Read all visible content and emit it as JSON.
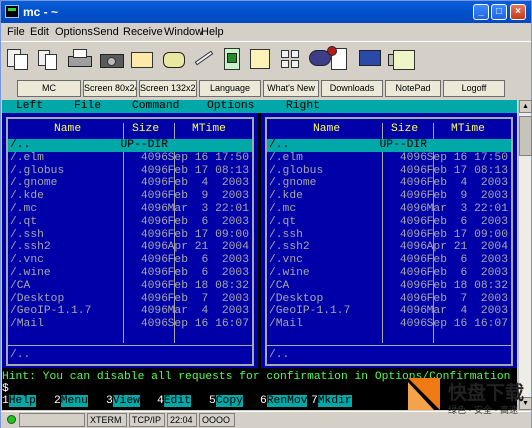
{
  "window": {
    "title": "mc - ~",
    "controls": [
      "_",
      "□",
      "×"
    ]
  },
  "menubar": [
    "File",
    "Edit",
    "Options",
    "Send",
    "Receive",
    "Window",
    "Help"
  ],
  "toolbar_icons": [
    "paste-icon",
    "copy-icon",
    "print-icon",
    "camera-icon",
    "open-icon",
    "phone-icon",
    "send-icon",
    "upload-icon",
    "download-icon",
    "grid-icon",
    "chat-icon",
    "spellcheck-icon",
    "display-icon",
    "keyboard-icon",
    "image-icon"
  ],
  "buttons": [
    "MC",
    "Screen 80x24",
    "Screen 132x24",
    "Language",
    "What's New",
    "Downloads",
    "NotePad",
    "Logoff"
  ],
  "mc_menu": [
    "Left",
    "File",
    "Command",
    "Options",
    "Right"
  ],
  "columns": {
    "name": "Name",
    "size": "Size",
    "mtime": "MTime"
  },
  "left_panel": {
    "files": [
      {
        "name": "/..",
        "size": "UP--DIR",
        "mtime": ""
      },
      {
        "name": "/.elm",
        "size": "4096",
        "mtime": "Sep 16 17:50"
      },
      {
        "name": "/.globus",
        "size": "4096",
        "mtime": "Feb 17 08:13"
      },
      {
        "name": "/.gnome",
        "size": "4096",
        "mtime": "Feb  4  2003"
      },
      {
        "name": "/.kde",
        "size": "4096",
        "mtime": "Feb  9  2003"
      },
      {
        "name": "/.mc",
        "size": "4096",
        "mtime": "Mar  3 22:01"
      },
      {
        "name": "/.qt",
        "size": "4096",
        "mtime": "Feb  6  2003"
      },
      {
        "name": "/.ssh",
        "size": "4096",
        "mtime": "Feb 17 09:00"
      },
      {
        "name": "/.ssh2",
        "size": "4096",
        "mtime": "Apr 21  2004"
      },
      {
        "name": "/.vnc",
        "size": "4096",
        "mtime": "Feb  6  2003"
      },
      {
        "name": "/.wine",
        "size": "4096",
        "mtime": "Feb  6  2003"
      },
      {
        "name": "/CA",
        "size": "4096",
        "mtime": "Feb 18 08:32"
      },
      {
        "name": "/Desktop",
        "size": "4096",
        "mtime": "Feb  7  2003"
      },
      {
        "name": "/GeoIP-1.1.7",
        "size": "4096",
        "mtime": "Mar  4  2003"
      },
      {
        "name": "/Mail",
        "size": "4096",
        "mtime": "Sep 16 16:07"
      }
    ],
    "mini_status": "/.."
  },
  "right_panel": {
    "files": [
      {
        "name": "/..",
        "size": "UP--DIR",
        "mtime": ""
      },
      {
        "name": "/.elm",
        "size": "4096",
        "mtime": "Sep 16 17:50"
      },
      {
        "name": "/.globus",
        "size": "4096",
        "mtime": "Feb 17 08:13"
      },
      {
        "name": "/.gnome",
        "size": "4096",
        "mtime": "Feb  4  2003"
      },
      {
        "name": "/.kde",
        "size": "4096",
        "mtime": "Feb  9  2003"
      },
      {
        "name": "/.mc",
        "size": "4096",
        "mtime": "Mar  3 22:01"
      },
      {
        "name": "/.qt",
        "size": "4096",
        "mtime": "Feb  6  2003"
      },
      {
        "name": "/.ssh",
        "size": "4096",
        "mtime": "Feb 17 09:00"
      },
      {
        "name": "/.ssh2",
        "size": "4096",
        "mtime": "Apr 21  2004"
      },
      {
        "name": "/.vnc",
        "size": "4096",
        "mtime": "Feb  6  2003"
      },
      {
        "name": "/.wine",
        "size": "4096",
        "mtime": "Feb  6  2003"
      },
      {
        "name": "/CA",
        "size": "4096",
        "mtime": "Feb 18 08:32"
      },
      {
        "name": "/Desktop",
        "size": "4096",
        "mtime": "Feb  7  2003"
      },
      {
        "name": "/GeoIP-1.1.7",
        "size": "4096",
        "mtime": "Mar  4  2003"
      },
      {
        "name": "/Mail",
        "size": "4096",
        "mtime": "Sep 16 16:07"
      }
    ],
    "mini_status": "/.."
  },
  "hint": "Hint: You can disable all requests for confirmation in Options/Confirmation",
  "prompt": "$",
  "fkeys": [
    {
      "num": "1",
      "label": "Help"
    },
    {
      "num": "2",
      "label": "Menu"
    },
    {
      "num": "3",
      "label": "View"
    },
    {
      "num": "4",
      "label": "Edit"
    },
    {
      "num": "5",
      "label": "Copy"
    },
    {
      "num": "6",
      "label": "RenMov"
    },
    {
      "num": "7",
      "label": "Mkdir"
    }
  ],
  "statusbar": {
    "term": "XTERM",
    "proto": "TCP/IP",
    "time": "22:04",
    "indicator": "OOOO"
  },
  "watermark": {
    "title": "快盘下载",
    "subtitle": "绿色 · 安全 · 高速"
  },
  "colors": {
    "panel": "#0000a8",
    "cyan": "#00a8a8",
    "hint": "#54fc54",
    "header": "#ffff54"
  }
}
